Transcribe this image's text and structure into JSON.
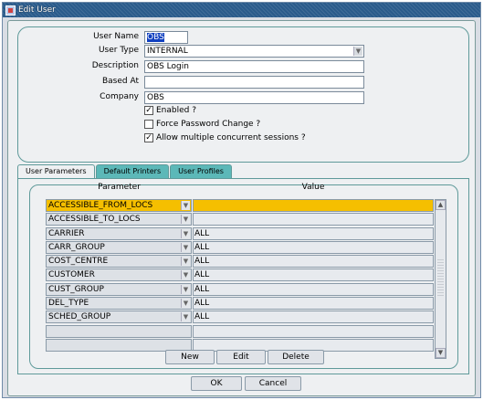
{
  "window": {
    "title": "Edit User"
  },
  "form": {
    "user_name_label": "User Name",
    "user_name_value": "OBS",
    "user_type_label": "User Type",
    "user_type_value": "INTERNAL",
    "description_label": "Description",
    "description_value": "OBS Login",
    "based_at_label": "Based At",
    "based_at_value": "",
    "company_label": "Company",
    "company_value": "OBS",
    "enabled_label": "Enabled ?",
    "enabled_checked": true,
    "force_pw_label": "Force Password Change ?",
    "force_pw_checked": false,
    "multi_sessions_label": "Allow multiple concurrent sessions ?",
    "multi_sessions_checked": true
  },
  "tabs": [
    {
      "label": "User Parameters",
      "active": true
    },
    {
      "label": "Default Printers",
      "active": false
    },
    {
      "label": "User Profiles",
      "active": false
    }
  ],
  "grid": {
    "parameter_header": "Parameter",
    "value_header": "Value",
    "rows": [
      {
        "parameter": "ACCESSIBLE_FROM_LOCS",
        "value": ""
      },
      {
        "parameter": "ACCESSIBLE_TO_LOCS",
        "value": ""
      },
      {
        "parameter": "CARRIER",
        "value": "ALL"
      },
      {
        "parameter": "CARR_GROUP",
        "value": "ALL"
      },
      {
        "parameter": "COST_CENTRE",
        "value": "ALL"
      },
      {
        "parameter": "CUSTOMER",
        "value": "ALL"
      },
      {
        "parameter": "CUST_GROUP",
        "value": "ALL"
      },
      {
        "parameter": "DEL_TYPE",
        "value": "ALL"
      },
      {
        "parameter": "SCHED_GROUP",
        "value": "ALL"
      },
      {
        "parameter": "",
        "value": ""
      },
      {
        "parameter": "",
        "value": ""
      }
    ]
  },
  "grid_buttons": {
    "new": "New",
    "edit": "Edit",
    "delete": "Delete"
  },
  "dialog_buttons": {
    "ok": "OK",
    "cancel": "Cancel"
  },
  "colors": {
    "selected_row": "#f5bf00",
    "title_bar": "#2a5b8b",
    "tab_inactive": "#5cb8b8"
  }
}
